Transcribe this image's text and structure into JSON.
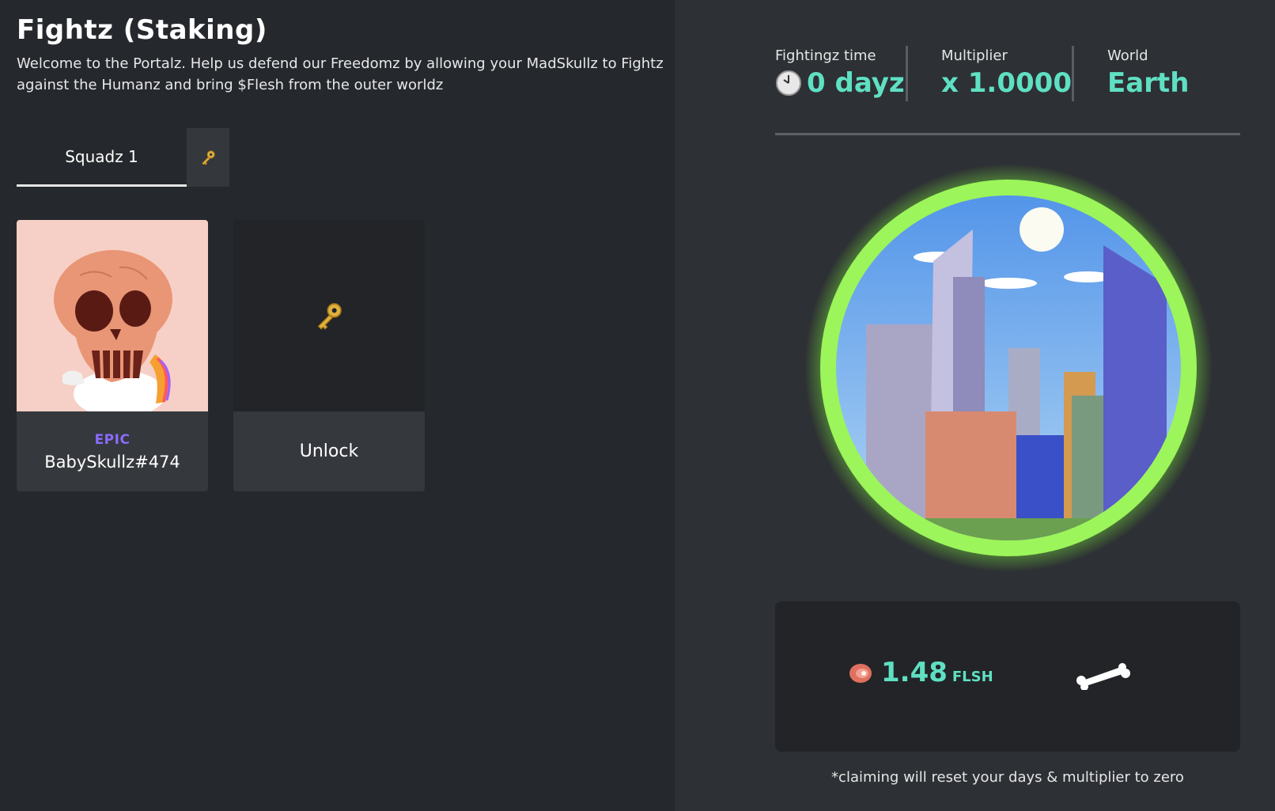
{
  "header": {
    "title": "Fightz (Staking)",
    "description": "Welcome to the Portalz. Help us defend our Freedomz by allowing your MadSkullz to Fightz against the Humanz and bring $Flesh from the outer worldz"
  },
  "squad": {
    "tab_label": "Squadz 1",
    "key_icon": "key-icon"
  },
  "cards": [
    {
      "rarity": "EPIC",
      "name": "BabySkullz#474"
    },
    {
      "label": "Unlock"
    }
  ],
  "stats": {
    "time_label": "Fightingz time",
    "time_value": "0 dayz",
    "multiplier_label": "Multiplier",
    "multiplier_value": "x 1.0000",
    "world_label": "World",
    "world_value": "Earth"
  },
  "claim": {
    "amount": "1.48",
    "unit": "FLSH",
    "note": "*claiming will reset your days & multiplier to zero"
  },
  "colors": {
    "accent": "#5fe0c2",
    "rarity_epic": "#8a6cff",
    "portal_glow": "#7cf03a"
  }
}
